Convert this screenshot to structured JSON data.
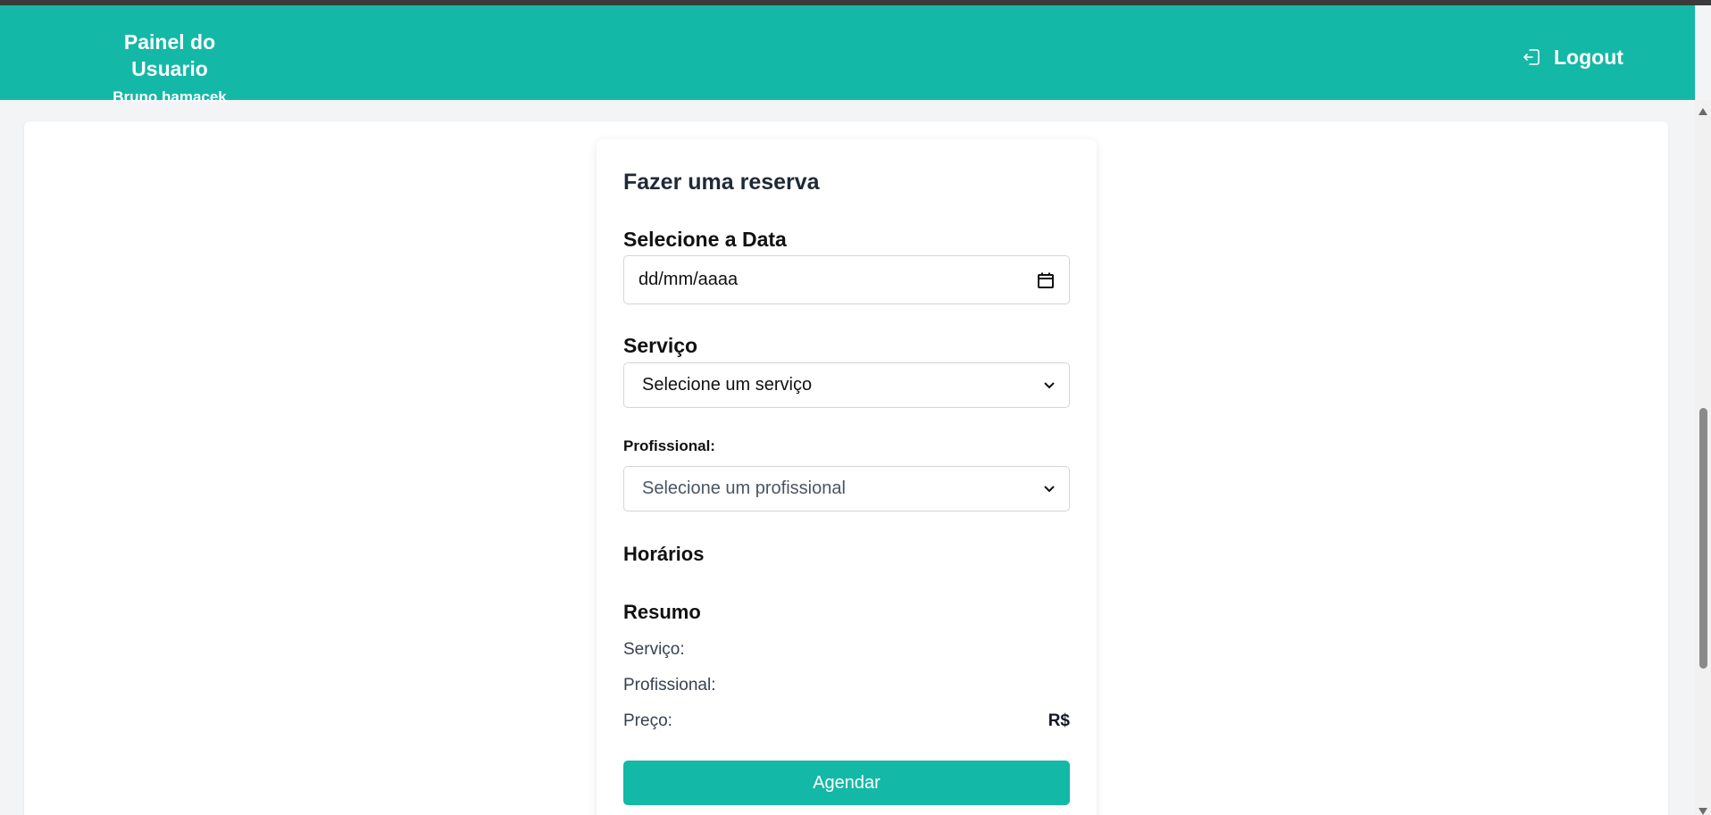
{
  "header": {
    "title": "Painel do Usuario",
    "user_name": "Bruno hamacek",
    "logout_label": "Logout",
    "bg_color": "#14b8a6"
  },
  "form": {
    "title": "Fazer uma reserva",
    "date_label": "Selecione a Data",
    "date_placeholder": "dd/mm/aaaa",
    "service_label": "Serviço",
    "service_selected": "Selecione um serviço",
    "professional_label": "Profissional:",
    "professional_selected": "Selecione um profissional",
    "horarios_heading": "Horários",
    "resumo_heading": "Resumo",
    "summary": [
      {
        "label": "Serviço:",
        "value": ""
      },
      {
        "label": "Profissional:",
        "value": ""
      },
      {
        "label": "Preço:",
        "value": "R$"
      }
    ],
    "submit_label": "Agendar"
  },
  "icons": {
    "logout": "logout-icon",
    "calendar": "calendar-icon",
    "chevron": "chevron-down-icon"
  }
}
